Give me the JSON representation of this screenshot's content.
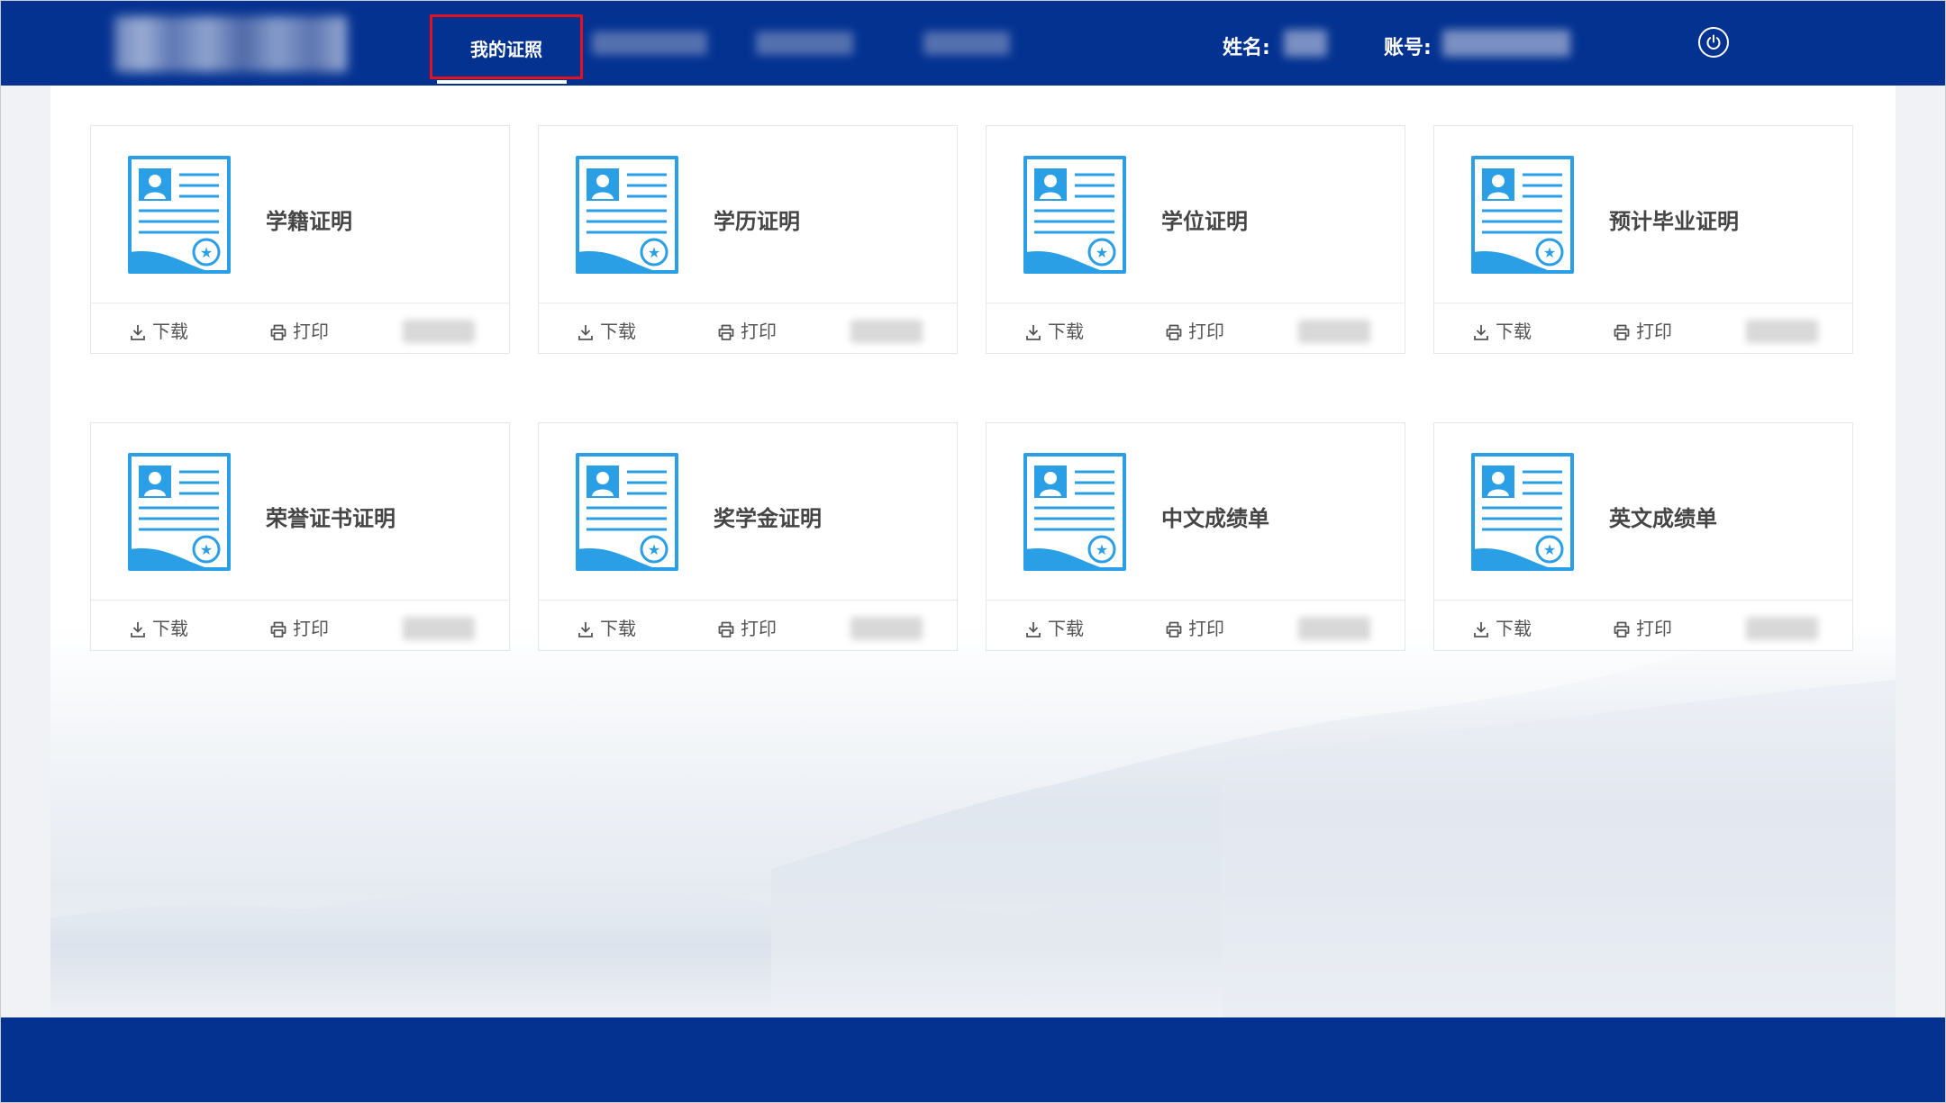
{
  "header": {
    "nav_active_label": "我的证照",
    "name_label": "姓名:",
    "account_label": "账号:"
  },
  "cards": [
    {
      "title": "学籍证明",
      "download_label": "下载",
      "print_label": "打印"
    },
    {
      "title": "学历证明",
      "download_label": "下载",
      "print_label": "打印"
    },
    {
      "title": "学位证明",
      "download_label": "下载",
      "print_label": "打印"
    },
    {
      "title": "预计毕业证明",
      "download_label": "下载",
      "print_label": "打印"
    },
    {
      "title": "荣誉证书证明",
      "download_label": "下载",
      "print_label": "打印"
    },
    {
      "title": "奖学金证明",
      "download_label": "下载",
      "print_label": "打印"
    },
    {
      "title": "中文成绩单",
      "download_label": "下载",
      "print_label": "打印"
    },
    {
      "title": "英文成绩单",
      "download_label": "下载",
      "print_label": "打印"
    }
  ],
  "colors": {
    "header_bg": "#043291",
    "footer_bg": "#043291",
    "highlight_border": "#e3101d",
    "icon_blue": "#2a9fe6",
    "card_title": "#454545"
  }
}
